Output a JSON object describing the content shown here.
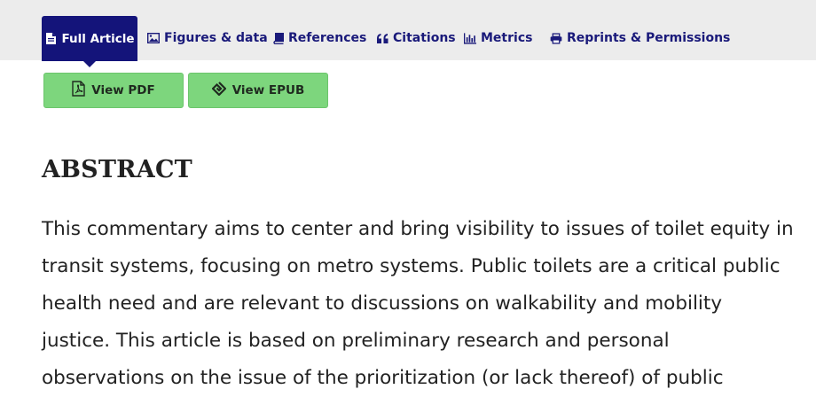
{
  "tabs": {
    "full_article": "Full Article",
    "figures": "Figures & data",
    "references": "References",
    "citations": "Citations",
    "metrics": "Metrics",
    "reprints": "Reprints & Permissions"
  },
  "buttons": {
    "view_pdf": "View PDF",
    "view_epub": "View EPUB"
  },
  "abstract": {
    "heading": "ABSTRACT",
    "text": "This commentary aims to center and bring visibility to issues of toilet equity in transit systems, focusing on metro systems. Public toilets are a critical public health need and are relevant to discussions on walkability and mobility justice. This article is based on preliminary research and personal observations on the issue of the prioritization (or lack thereof) of public"
  },
  "colors": {
    "tab_active_bg": "#14147a",
    "tab_text": "#1a1a7a",
    "button_bg": "#7dd67d",
    "tabbar_bg": "#ececec"
  },
  "icons": {
    "full_article": "document-icon",
    "figures": "image-icon",
    "references": "book-icon",
    "citations": "quote-icon",
    "metrics": "bar-chart-icon",
    "reprints": "printer-icon",
    "view_pdf": "pdf-file-icon",
    "view_epub": "epub-icon"
  }
}
